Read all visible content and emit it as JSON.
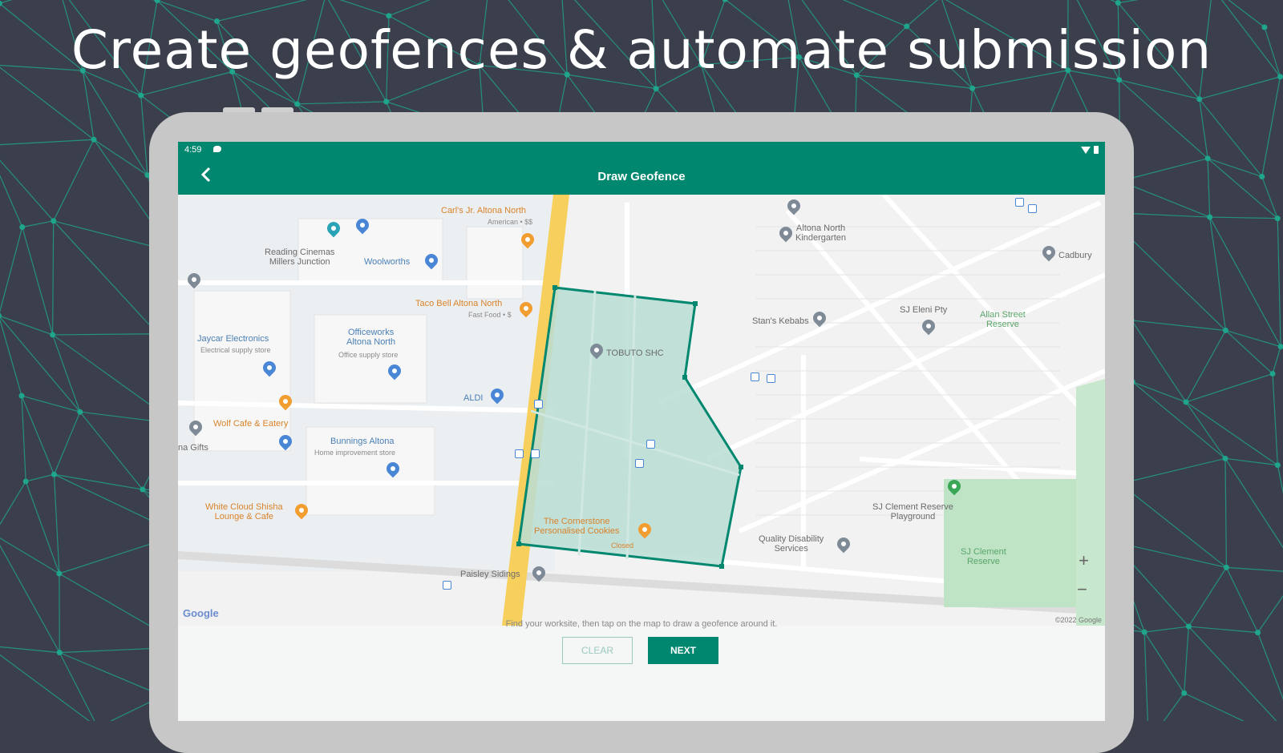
{
  "headline": "Create geofences & automate submission",
  "status_bar": {
    "time": "4:59"
  },
  "app_bar": {
    "title": "Draw Geofence"
  },
  "map": {
    "labels": {
      "carls_jr": "Carl's Jr. Altona North",
      "carls_jr_sub": "American • $$",
      "reading_cinemas": "Reading Cinemas\nMillers Junction",
      "woolworths": "Woolworths",
      "taco_bell": "Taco Bell Altona North",
      "taco_bell_sub": "Fast Food • $",
      "jaycar": "Jaycar Electronics",
      "jaycar_sub": "Electrical supply store",
      "officeworks": "Officeworks\nAltona North",
      "officeworks_sub": "Office supply store",
      "aldi": "ALDI",
      "wolf_cafe": "Wolf Cafe & Eatery",
      "bunnings": "Bunnings Altona",
      "bunnings_sub": "Home improvement store",
      "white_cloud": "White Cloud Shisha\nLounge & Cafe",
      "tbs": "TOBUTO SHC",
      "cornerstone": "The Cornerstone\nPersonalised Cookies",
      "cornerstone_sub": "Closed",
      "paisley": "Paisley Sidings",
      "altona_kinder": "Altona North\nKindergarten",
      "stans_kebabs": "Stan's Kebabs",
      "sj_fifth": "SJ Eleni Pty",
      "allan_street": "Allan Street\nReserve",
      "sj_clement_playground": "SJ Clement Reserve\nPlayground",
      "sj_clement_reserve": "SJ Clement\nReserve",
      "quality_disability": "Quality Disability\nServices",
      "cadbury": "Cadbury",
      "na_gifts": "na Gifts"
    },
    "logo": "Google",
    "copyright": "©2022 Google",
    "zoom_in": "+",
    "zoom_out": "−"
  },
  "instructions": "Find your worksite, then tap on the map to draw a geofence around it.",
  "buttons": {
    "clear": "CLEAR",
    "next": "NEXT"
  },
  "colors": {
    "primary": "#00876f",
    "background": "#3b3f4c",
    "network": "#1fa58c",
    "geofence_fill": "#b8ddd3"
  },
  "icons": {
    "back": "chevron-left-icon"
  }
}
